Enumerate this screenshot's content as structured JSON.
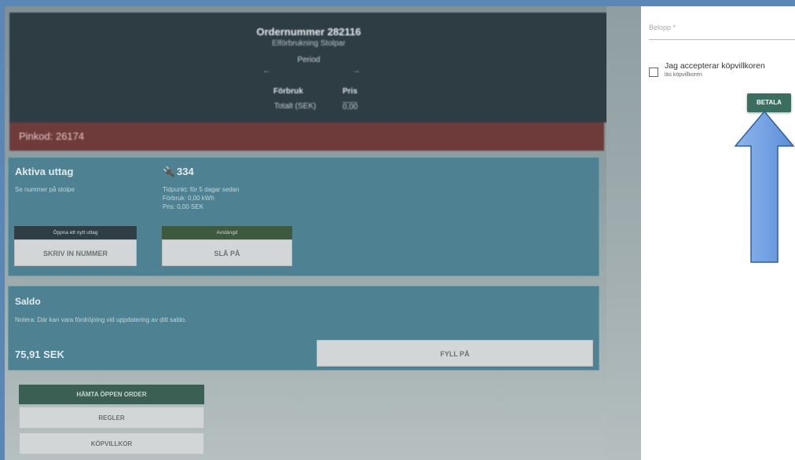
{
  "order": {
    "title": "Ordernummer 282116",
    "subtitle": "Elförbrukning Stolpar",
    "period_label": "Period",
    "col_forbruk": "Förbruk",
    "col_pris": "Pris",
    "total_label": "Totalt (SEK)",
    "total_value": "0,00"
  },
  "pin": {
    "text": "Pinkod: 26174"
  },
  "active": {
    "title": "Aktiva uttag",
    "subtitle": "Se nummer på stolpe",
    "socket_number": "334",
    "info_time": "Tidpunkt: för 5 dagar sedan",
    "info_usage": "Förbruk: 0,00 kWh",
    "info_price": "Pris: 0,00 SEK",
    "tag_open": "Öppna ett nytt uttag",
    "tag_off": "Avstängd",
    "btn_enter": "SKRIV IN NUMMER",
    "btn_on": "SLÅ PÅ"
  },
  "saldo": {
    "title": "Saldo",
    "note": "Notera: Där kan vara fördröjning vid uppdatering av ditt saldo.",
    "value": "75,91 SEK",
    "btn_fill": "FYLL PÅ"
  },
  "buttons": {
    "fetch_order": "HÄMTA ÖPPEN ORDER",
    "rules": "REGLER",
    "terms": "KÖPVILLKOR"
  },
  "payment": {
    "amount_label": "Belopp *",
    "terms_label": "Jag accepterar köpvillkoren",
    "terms_link": "läs köpvillkoren",
    "pay_button": "BETALA",
    "terms_checked": false
  },
  "colors": {
    "accent": "#3a6f5f",
    "arrow": "#5b8fd6",
    "frame": "#5b87b6"
  },
  "icons": {
    "socket": "plug-icon",
    "prev": "arrow-left-icon",
    "next": "arrow-right-icon",
    "callout": "arrow-up-icon"
  }
}
